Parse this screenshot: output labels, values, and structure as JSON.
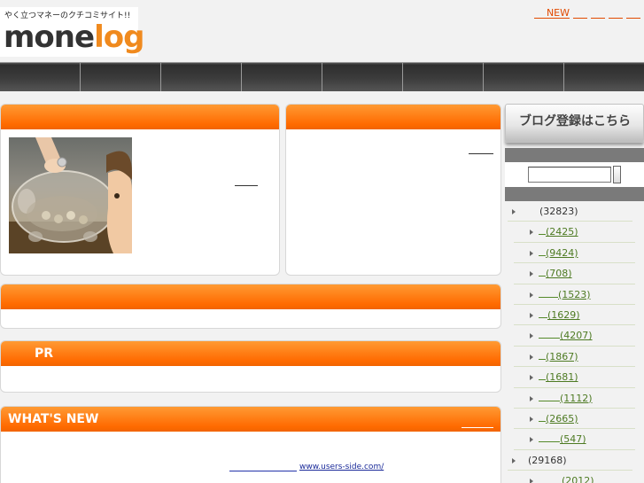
{
  "header": {
    "tagline": "やく立つマネーのクチコミサイト!!",
    "logo_part1": "mone",
    "logo_part2": "log",
    "top_links": [
      {
        "label": ""
      },
      {
        "label": "NEW"
      },
      {
        "label": ""
      },
      {
        "label": ""
      },
      {
        "label": ""
      },
      {
        "label": ""
      }
    ]
  },
  "nav": {
    "items": [
      "",
      "",
      "",
      "",
      "",
      "",
      "",
      ""
    ]
  },
  "boxes": {
    "box4_title": "PR",
    "box5_title": "WHAT'S NEW",
    "news_url": "www.users-side.com/"
  },
  "sidebar": {
    "register_label": "ブログ登録はこちら",
    "search_value": "",
    "categories": [
      {
        "level": "top",
        "count": "(32823)"
      },
      {
        "level": "sub",
        "count": "(2425)"
      },
      {
        "level": "sub",
        "count": "(9424)"
      },
      {
        "level": "sub",
        "count": "(708)"
      },
      {
        "level": "sub",
        "count": "(1523)"
      },
      {
        "level": "sub",
        "count": "(1629)"
      },
      {
        "level": "sub",
        "count": "(4207)"
      },
      {
        "level": "sub",
        "count": "(1867)"
      },
      {
        "level": "sub",
        "count": "(1681)"
      },
      {
        "level": "sub",
        "count": "(1112)"
      },
      {
        "level": "sub",
        "count": "(2665)"
      },
      {
        "level": "sub",
        "count": "(547)"
      },
      {
        "level": "top",
        "count": "(29168)"
      },
      {
        "level": "sub",
        "count": "(2012)"
      }
    ]
  },
  "colors": {
    "accent_orange": "#ff6a00",
    "link_red": "#e24a00",
    "count_green": "#4d7a22"
  }
}
